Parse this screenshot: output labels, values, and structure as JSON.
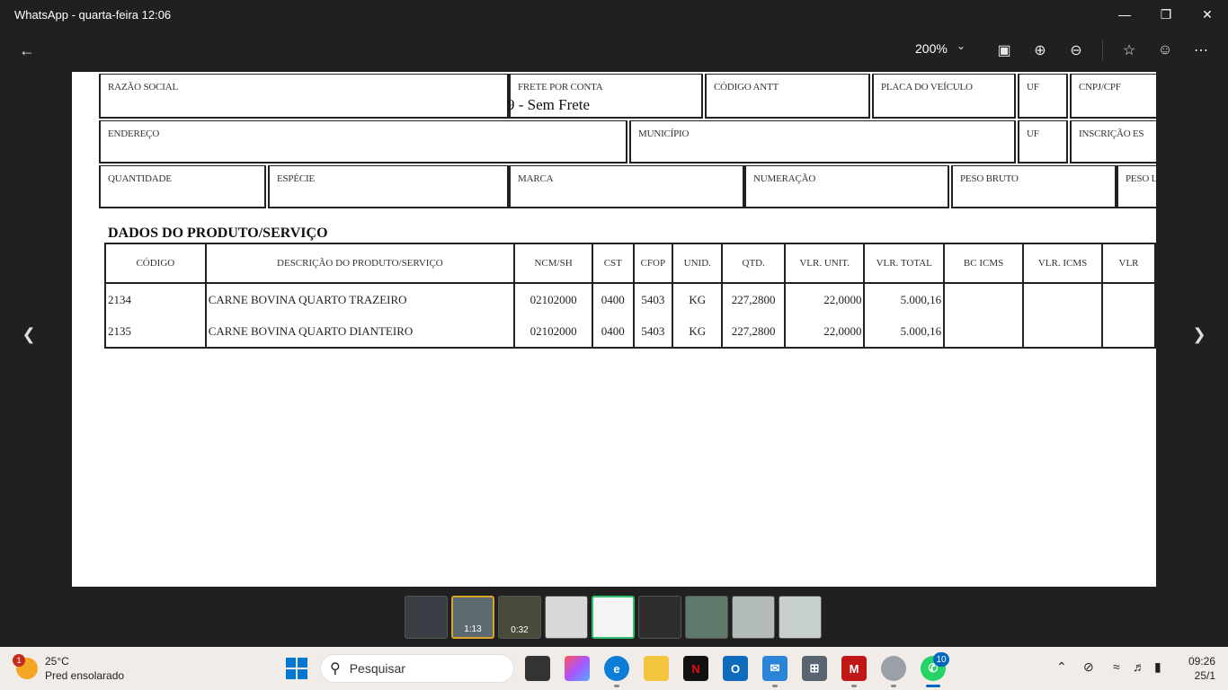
{
  "window": {
    "title": "WhatsApp - quarta-feira 12:06"
  },
  "toolbar": {
    "zoom": "200%"
  },
  "document": {
    "header_fields": {
      "razao_social": "RAZÃO SOCIAL",
      "frete_por_conta": "FRETE POR CONTA",
      "frete_valor": "9 - Sem Frete",
      "codigo_antt": "CÓDIGO ANTT",
      "placa_veiculo": "PLACA DO VEÍCULO",
      "uf1": "UF",
      "cnpj_cpf": "CNPJ/CPF",
      "endereco": "ENDEREÇO",
      "municipio": "MUNICÍPIO",
      "uf2": "UF",
      "inscricao_estadual": "INSCRIÇÃO ES",
      "quantidade": "QUANTIDADE",
      "especie": "ESPÉCIE",
      "marca": "MARCA",
      "numeracao": "NUMERAÇÃO",
      "peso_bruto": "PESO BRUTO",
      "peso_liquido": "PESO L"
    },
    "section_title": "DADOS DO PRODUTO/SERVIÇO",
    "columns": [
      "CÓDIGO",
      "DESCRIÇÃO DO PRODUTO/SERVIÇO",
      "NCM/SH",
      "CST",
      "CFOP",
      "UNID.",
      "QTD.",
      "VLR. UNIT.",
      "VLR. TOTAL",
      "BC ICMS",
      "VLR. ICMS",
      "VLR"
    ],
    "rows": [
      {
        "codigo": "2134",
        "descricao": "CARNE BOVINA QUARTO TRAZEIRO",
        "ncm": "02102000",
        "cst": "0400",
        "cfop": "5403",
        "unid": "KG",
        "qtd": "227,2800",
        "vlr_unit": "22,0000",
        "vlr_total": "5.000,16"
      },
      {
        "codigo": "2135",
        "descricao": "CARNE BOVINA QUARTO DIANTEIRO",
        "ncm": "02102000",
        "cst": "0400",
        "cfop": "5403",
        "unid": "KG",
        "qtd": "227,2800",
        "vlr_unit": "22,0000",
        "vlr_total": "5.000,16"
      }
    ]
  },
  "thumbnails": [
    {
      "duration": ""
    },
    {
      "duration": "1:13"
    },
    {
      "duration": "0:32"
    },
    {
      "duration": ""
    },
    {
      "duration": ""
    },
    {
      "duration": ""
    },
    {
      "duration": ""
    },
    {
      "duration": ""
    },
    {
      "duration": ""
    }
  ],
  "taskbar": {
    "weather_temp": "25°C",
    "weather_desc": "Pred ensolarado",
    "weather_badge": "1",
    "search_placeholder": "Pesquisar",
    "whatsapp_badge": "10",
    "time": "09:26",
    "date": "25/1"
  },
  "colors": {
    "accent": "#2fbf71",
    "taskbar_bg": "#f1ece8",
    "app_bg": "#202020"
  }
}
